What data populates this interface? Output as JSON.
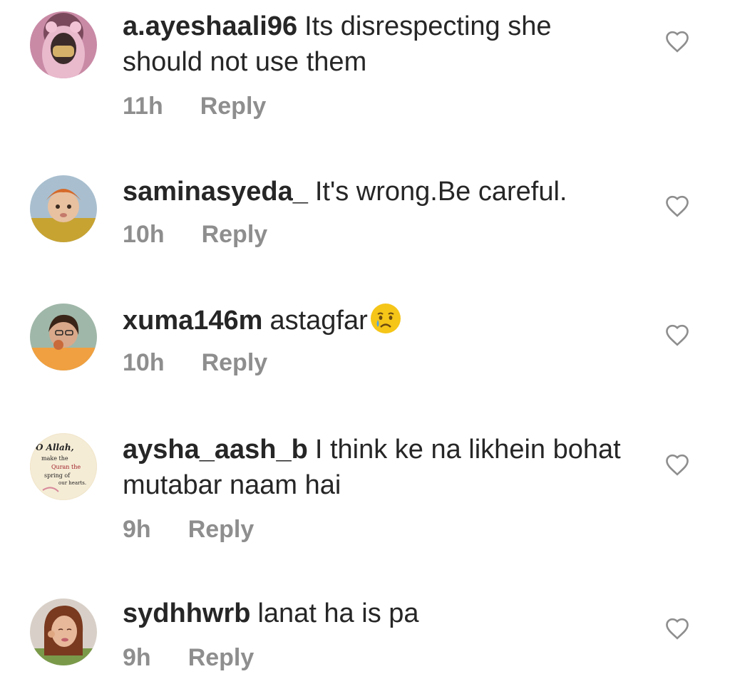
{
  "comments": [
    {
      "username": "a.ayeshaali96",
      "text": "Its disrespecting she should not use them",
      "time": "11h",
      "reply_label": "Reply"
    },
    {
      "username": "saminasyeda_",
      "text": "It's wrong.Be careful.",
      "time": "10h",
      "reply_label": "Reply"
    },
    {
      "username": "xuma146m",
      "text": "astagfar",
      "emoji": "crying-face-emoji",
      "time": "10h",
      "reply_label": "Reply"
    },
    {
      "username": "aysha_aash_b",
      "text": "I think ke na likhein bohat mutabar naam hai",
      "time": "9h",
      "reply_label": "Reply",
      "avatar_text": {
        "line1": "O Allah,",
        "line2": "make the",
        "line3": "Quran the",
        "line4": "spring of",
        "line5": "our hearts."
      }
    },
    {
      "username": "sydhhwrb",
      "text": "lanat ha is pa",
      "time": "9h",
      "reply_label": "Reply"
    }
  ],
  "icons": {
    "like": "heart-outline-icon"
  },
  "colors": {
    "text": "#262626",
    "meta": "#8e8e8e",
    "background": "#ffffff"
  }
}
